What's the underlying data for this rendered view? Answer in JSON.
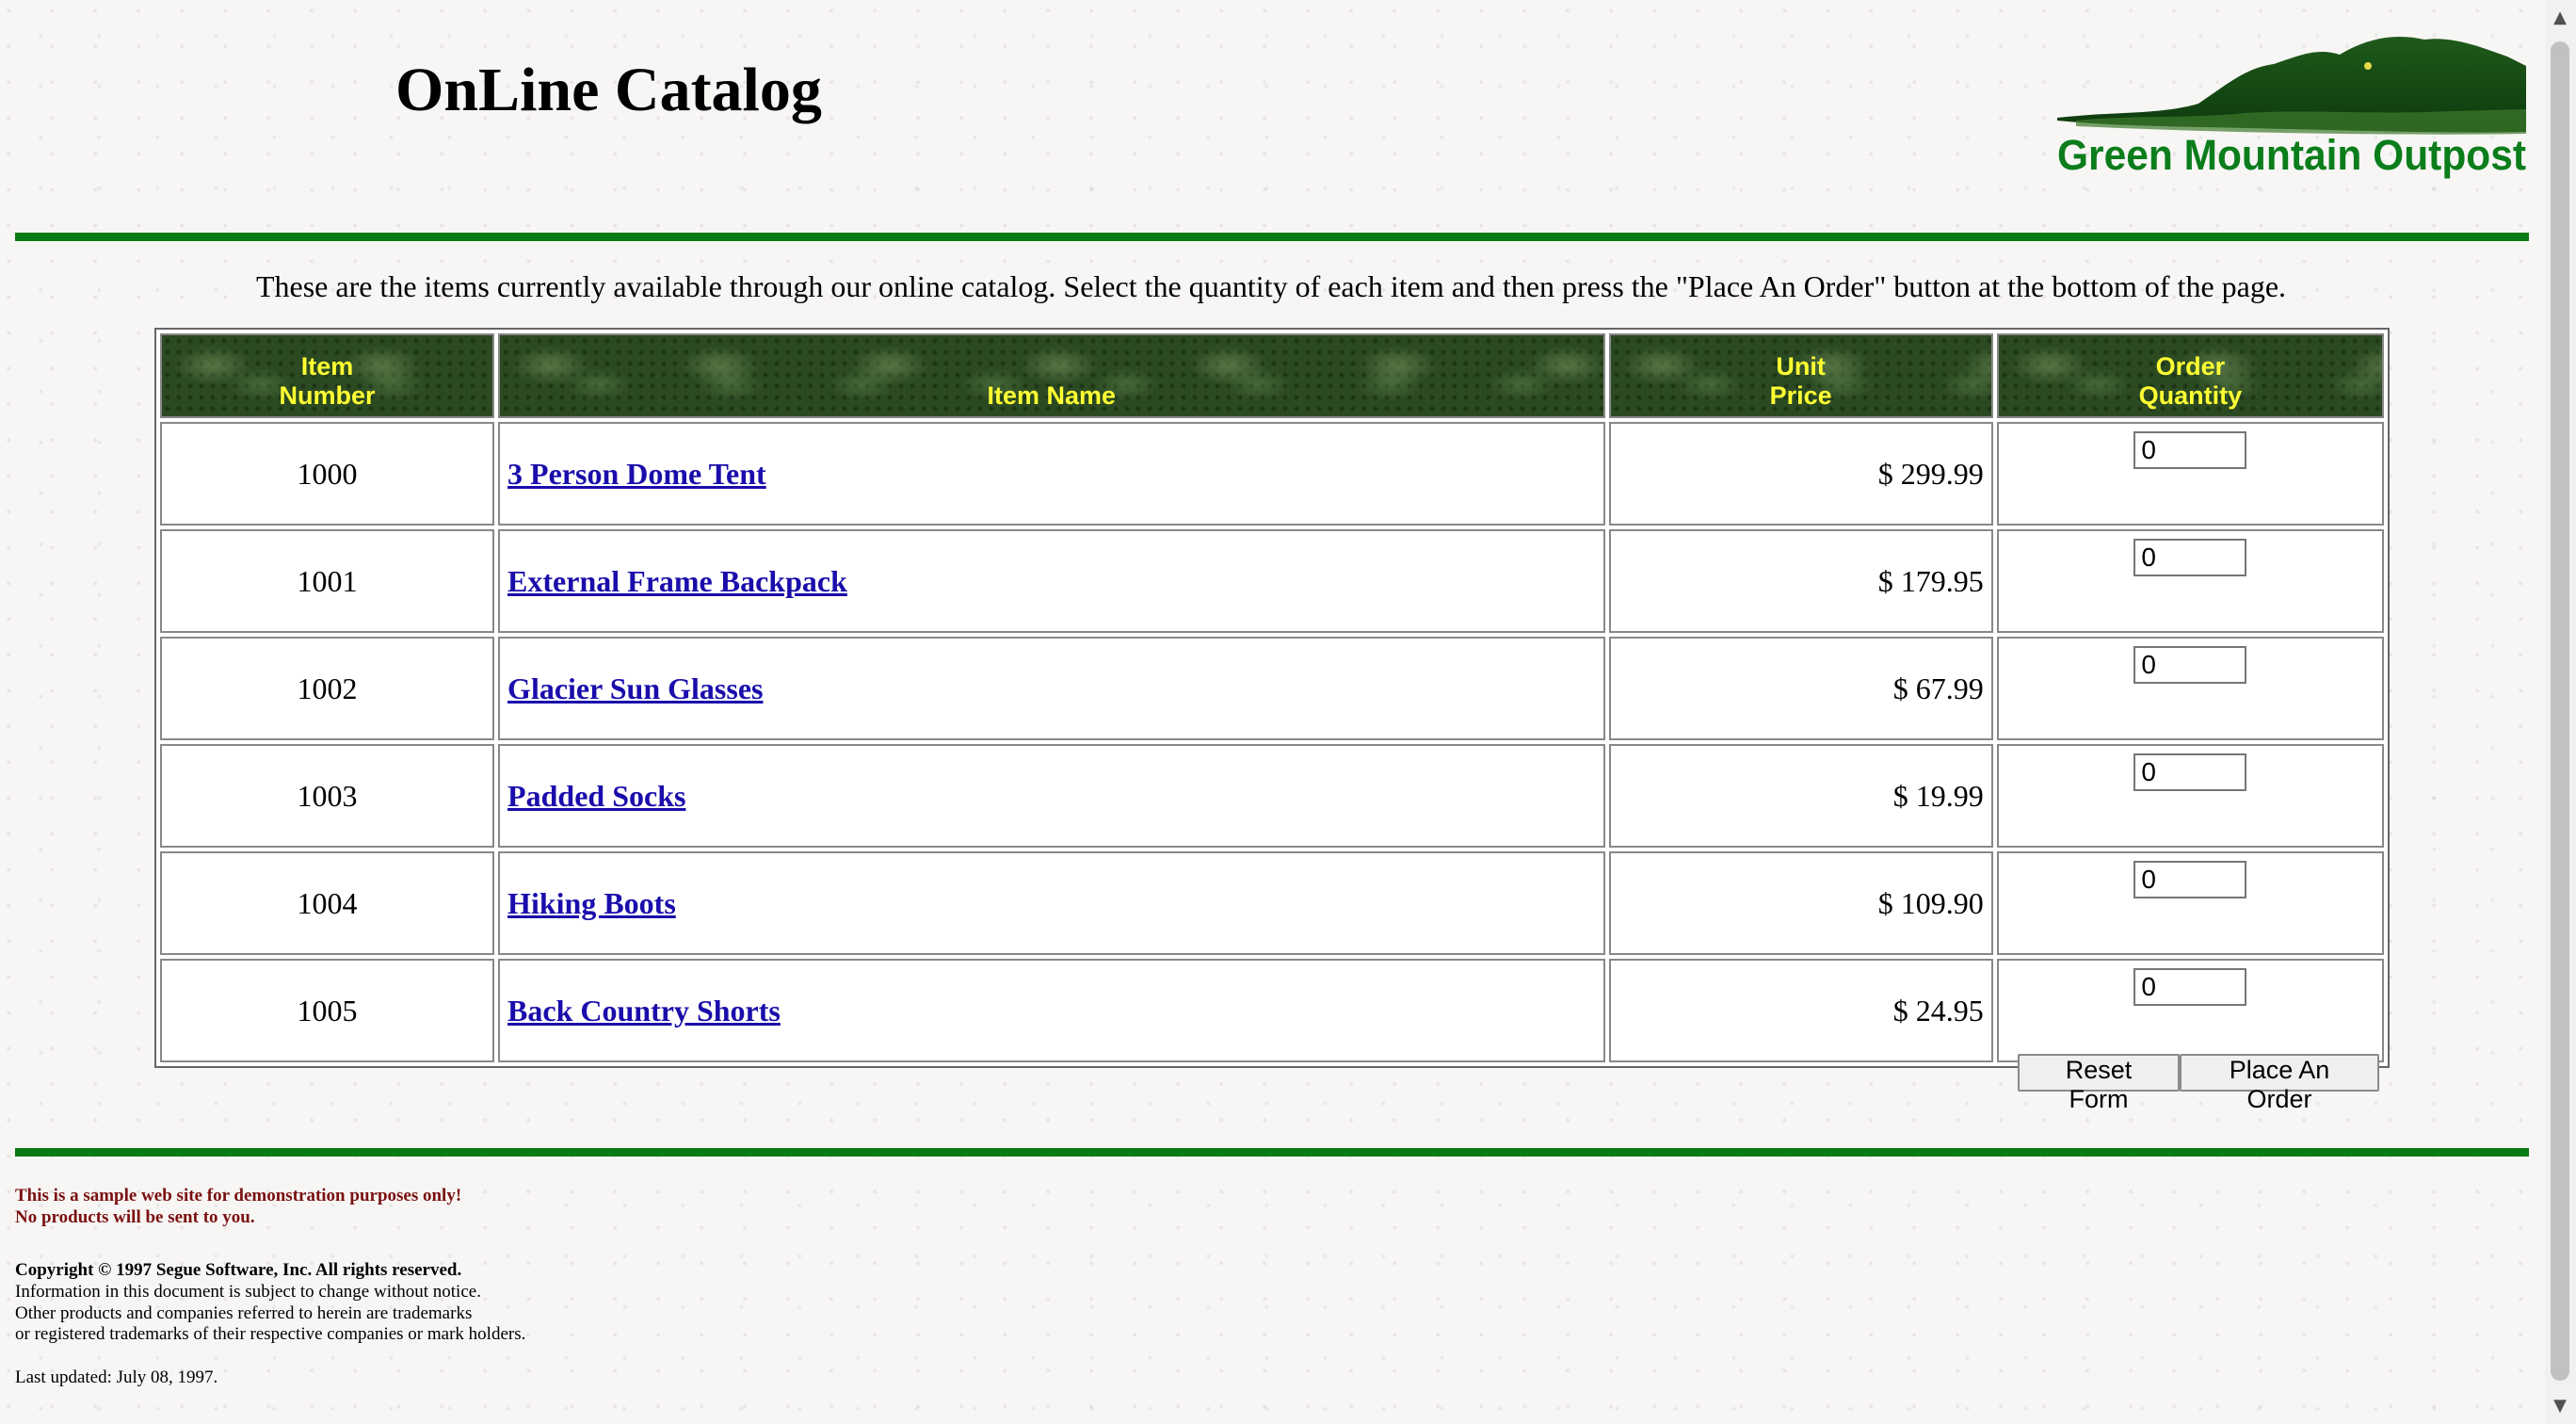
{
  "page": {
    "title": "OnLine Catalog",
    "logo_text": "Green Mountain Outpost",
    "intro": "These are the items currently available through our online catalog. Select the quantity of each item and then press the \"Place An Order\" button at the bottom of the page."
  },
  "table": {
    "headers": {
      "item_number": [
        "Item",
        "Number"
      ],
      "item_name": "Item Name",
      "unit_price": [
        "Unit",
        "Price"
      ],
      "order_quantity": [
        "Order",
        "Quantity"
      ]
    },
    "rows": [
      {
        "number": "1000",
        "name": "3 Person Dome Tent",
        "price": "$ 299.99",
        "qty": "0"
      },
      {
        "number": "1001",
        "name": "External Frame Backpack",
        "price": "$ 179.95",
        "qty": "0"
      },
      {
        "number": "1002",
        "name": "Glacier Sun Glasses",
        "price": "$ 67.99",
        "qty": "0"
      },
      {
        "number": "1003",
        "name": "Padded Socks",
        "price": "$ 19.99",
        "qty": "0"
      },
      {
        "number": "1004",
        "name": "Hiking Boots",
        "price": "$ 109.90",
        "qty": "0"
      },
      {
        "number": "1005",
        "name": "Back Country Shorts",
        "price": "$ 24.95",
        "qty": "0"
      }
    ]
  },
  "buttons": {
    "reset": "Reset Form",
    "place_order": "Place An Order"
  },
  "footer": {
    "disclaimer": [
      "This is a sample web site for demonstration purposes only!",
      "No products will be sent to you."
    ],
    "copyright": "Copyright © 1997 Segue Software, Inc. All rights reserved.",
    "notice": [
      "Information in this document is subject to change without notice.",
      "Other products and companies referred to herein are trademarks",
      "or registered trademarks of their respective companies or mark holders."
    ],
    "last_updated": "Last updated: July 08, 1997."
  },
  "colors": {
    "rule": "#0a7a12",
    "header_text": "#ffff33",
    "link": "#1a0dab",
    "disclaimer": "#7a1010",
    "logo_text": "#0b7d1b"
  }
}
